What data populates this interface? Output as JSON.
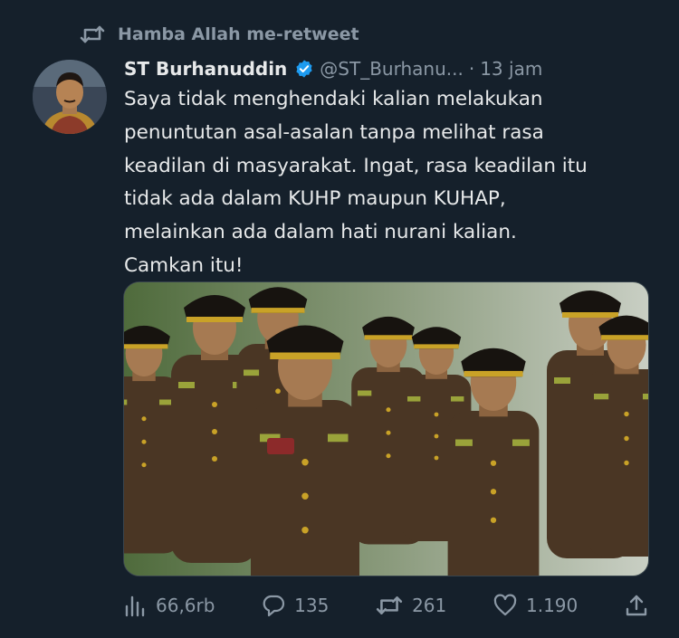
{
  "retweet_context": {
    "icon": "retweet-icon",
    "label": "Hamba Allah me-retweet"
  },
  "tweet": {
    "author_name": "ST Burhanuddin",
    "verified": true,
    "handle": "@ST_Burhanu...",
    "separator": "·",
    "time": "13 jam",
    "text_lines": [
      "Saya tidak menghendaki kalian melakukan",
      "penuntutan asal-asalan tanpa melihat rasa",
      "keadilan di masyarakat. Ingat, rasa keadilan itu",
      "tidak ada dalam KUHP maupun KUHAP,",
      "melainkan ada dalam hati nurani kalian.",
      "Camkan itu!"
    ]
  },
  "actions": {
    "views": {
      "icon": "analytics-icon",
      "value": "66,6rb"
    },
    "replies": {
      "icon": "reply-icon",
      "value": "135"
    },
    "retweets": {
      "icon": "retweet-icon",
      "value": "261"
    },
    "likes": {
      "icon": "heart-icon",
      "value": "1.190"
    },
    "share": {
      "icon": "share-icon"
    }
  },
  "colors": {
    "background": "#15202b",
    "text": "#e7e9ea",
    "muted": "#8b98a5",
    "verified": "#1d9bf0",
    "uniform": "#4e3a26",
    "cap_band": "#c9a227"
  }
}
